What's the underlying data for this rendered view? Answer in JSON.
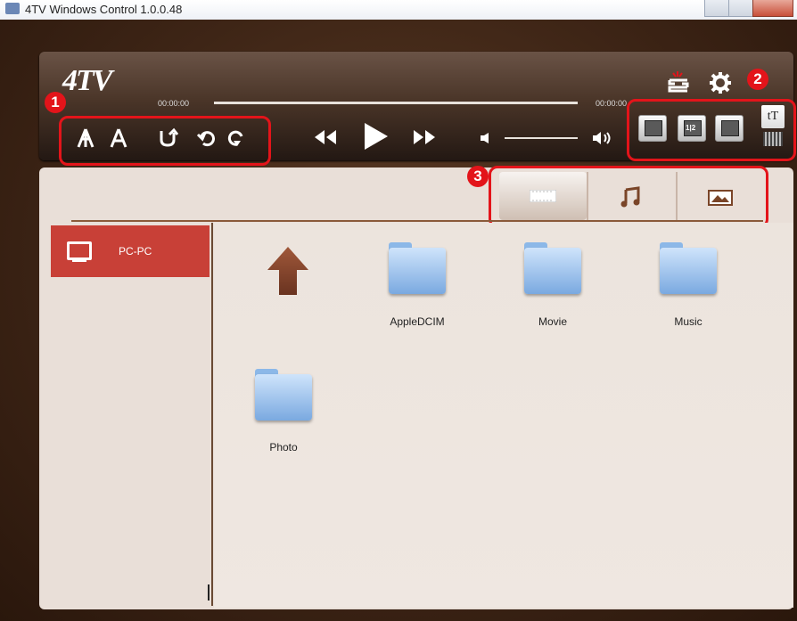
{
  "window": {
    "title": "4TV Windows Control 1.0.0.48"
  },
  "player": {
    "logo": "4TV",
    "time_start": "00:00:00",
    "time_end": "00:00:00",
    "progress": 0,
    "volume": 1.0
  },
  "badges": {
    "one": "1",
    "two": "2",
    "three": "3"
  },
  "screen_buttons": {
    "b1": "",
    "b2": "1|2",
    "b3": ""
  },
  "text_size": {
    "label": "tT"
  },
  "tabs": [
    {
      "name": "video",
      "icon": "film-icon",
      "selected": true
    },
    {
      "name": "music",
      "icon": "music-note-icon",
      "selected": false
    },
    {
      "name": "photo",
      "icon": "picture-icon",
      "selected": false
    }
  ],
  "sidebar": {
    "items": [
      {
        "label": "PC-PC",
        "icon": "monitor-icon"
      }
    ]
  },
  "files": [
    {
      "label": "AppleDCIM"
    },
    {
      "label": "Movie"
    },
    {
      "label": "Music"
    },
    {
      "label": "Photo"
    }
  ],
  "colors": {
    "accent_red": "#e3141a",
    "sidebar_selected": "#c84037",
    "folder_blue": "#8cb8e8"
  }
}
